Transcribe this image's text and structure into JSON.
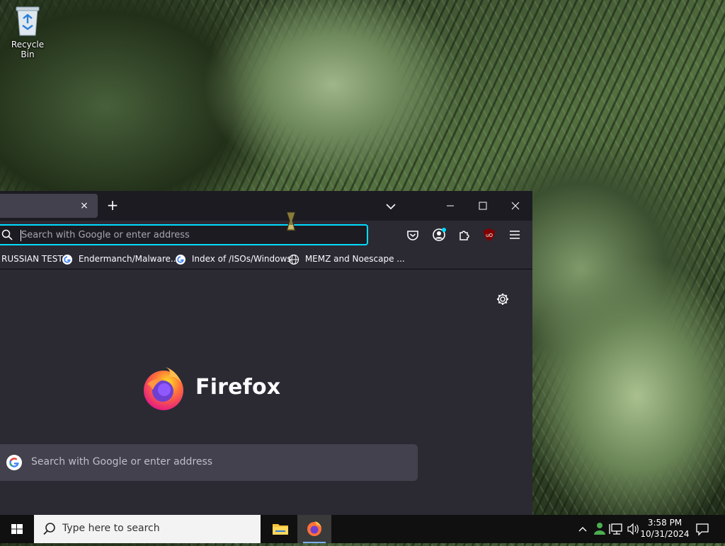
{
  "desktop": {
    "recycle_bin_label": "Recycle Bin"
  },
  "browser": {
    "app_name": "Firefox",
    "tab": {
      "close_icon": "×"
    },
    "new_tab_icon": "+",
    "url_bar": {
      "placeholder": "Search with Google or enter address",
      "value": ""
    },
    "bookmarks": [
      {
        "label": "RUSSIAN TEST",
        "icon": "none"
      },
      {
        "label": "Endermanch/Malware...",
        "icon": "google-icon"
      },
      {
        "label": "Index of /ISOs/Windows",
        "icon": "google-icon"
      },
      {
        "label": "MEMZ and Noescape ...",
        "icon": "globe-icon"
      }
    ],
    "new_tab_page": {
      "wordmark": "Firefox",
      "search_placeholder": "Search with Google or enter address"
    },
    "colors": {
      "accent_focus": "#00ddff",
      "toolbar": "#2b2a33",
      "frame": "#1c1b22"
    }
  },
  "taskbar": {
    "search_placeholder": "Type here to search",
    "clock_time": "3:58 PM",
    "clock_date": "10/31/2024",
    "apps": [
      "file-explorer",
      "firefox"
    ]
  }
}
